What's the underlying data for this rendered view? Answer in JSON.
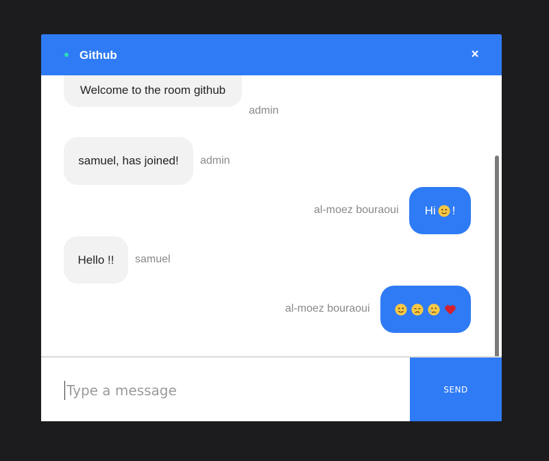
{
  "colors": {
    "accent": "#2f7bf5",
    "status_online": "#28e0b5",
    "page_background": "#1c1c1e"
  },
  "header": {
    "room_name": "Github",
    "close_label": "×"
  },
  "messages": [
    {
      "direction": "incoming",
      "text": "Welcome to the room github",
      "sender": "admin"
    },
    {
      "direction": "incoming",
      "text": "samuel, has joined!",
      "sender": "admin"
    },
    {
      "direction": "outgoing",
      "text_before": "Hi",
      "emojis": [
        "slightly-smiling-face-icon"
      ],
      "text_after": "!",
      "sender": "al-moez bouraoui"
    },
    {
      "direction": "incoming",
      "text": "Hello !!",
      "sender": "samuel"
    },
    {
      "direction": "outgoing",
      "emojis": [
        "slightly-smiling-face-icon",
        "disappointed-face-icon",
        "crying-face-icon",
        "red-heart-icon"
      ],
      "sender": "al-moez bouraoui"
    }
  ],
  "composer": {
    "placeholder": "Type a message",
    "value": ""
  },
  "send_label": "SEND"
}
